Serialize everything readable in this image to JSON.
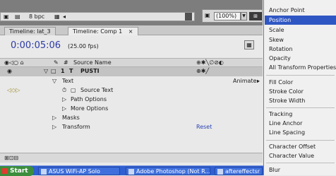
{
  "toolbar": {
    "bpc": "8 bpc",
    "zoom": "(100%)"
  },
  "tabs": [
    {
      "label": "Timeline: lat_3"
    },
    {
      "label": "Timeline: Comp 1",
      "close": "×"
    }
  ],
  "timecode": "0:00:05:06",
  "fps": "(25.00 fps)",
  "headers": {
    "hash": "#",
    "source_name": "Source Name"
  },
  "layer": {
    "number": "1",
    "type": "T",
    "name": "PUSTI"
  },
  "rows": {
    "text": "Text",
    "animate": "Animate:",
    "source_text": "Source Text",
    "path_options": "Path Options",
    "more_options": "More Options",
    "masks": "Masks",
    "transform": "Transform",
    "reset": "Reset"
  },
  "taskbar": {
    "start": "Start",
    "items": [
      {
        "label": "ASUS WiFi-AP Solo"
      },
      {
        "label": "Adobe Photoshop (Not R..."
      },
      {
        "label": "aftereffectsr"
      }
    ]
  },
  "menu": {
    "items": [
      {
        "label": "Anchor Point"
      },
      {
        "label": "Position",
        "selected": true
      },
      {
        "label": "Scale"
      },
      {
        "label": "Skew"
      },
      {
        "label": "Rotation"
      },
      {
        "label": "Opacity"
      },
      {
        "label": "All Transform Properties"
      },
      {
        "label": "Fill Color"
      },
      {
        "label": "Stroke Color"
      },
      {
        "label": "Stroke Width"
      },
      {
        "label": "Tracking"
      },
      {
        "label": "Line Anchor"
      },
      {
        "label": "Line Spacing"
      },
      {
        "label": "Character Offset"
      },
      {
        "label": "Character Value"
      },
      {
        "label": "Blur"
      }
    ]
  },
  "colors": {
    "menu_selection": "#2f57c3",
    "timecode": "#2d3aa6",
    "link": "#2a45b3",
    "taskbar": "#2f5fd0"
  }
}
